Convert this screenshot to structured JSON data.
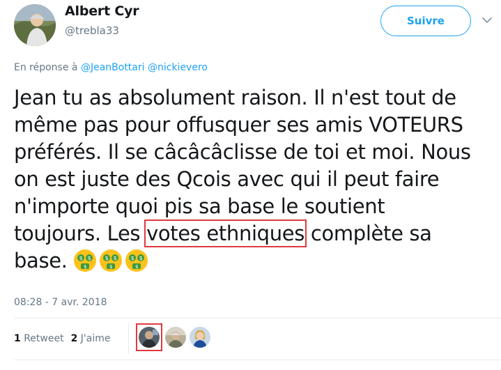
{
  "user": {
    "name": "Albert Cyr",
    "handle": "@trebla33"
  },
  "follow_button": {
    "label": "Suivre"
  },
  "reply": {
    "prefix": "En réponse à",
    "mentions": [
      "@JeanBottari",
      "@nickievero"
    ]
  },
  "tweet": {
    "lines": [
      "Jean tu as absolument raison. Il n'est tout de",
      "même pas pour offusquer ses amis VOTEURS",
      "préférés. Il se câcâcâclisse de toi et moi. Nous",
      "on est juste des Qcois avec qui il peut faire",
      "n'importe quoi pis sa base le soutient"
    ],
    "line6_before": "toujours. Les ",
    "highlight": "votes ethniques",
    "line6_after": " complète sa",
    "line7": "base.",
    "emoji": [
      "money-mouth-face",
      "money-mouth-face",
      "money-mouth-face"
    ],
    "timestamp": "08:28 - 7 avr. 2018"
  },
  "stats": {
    "retweets_count": "1",
    "retweets_label": "Retweet",
    "likes_count": "2",
    "likes_label": "J'aime"
  },
  "colors": {
    "accent": "#1da1f2",
    "muted": "#657786",
    "highlight_box": "#e0393e"
  }
}
